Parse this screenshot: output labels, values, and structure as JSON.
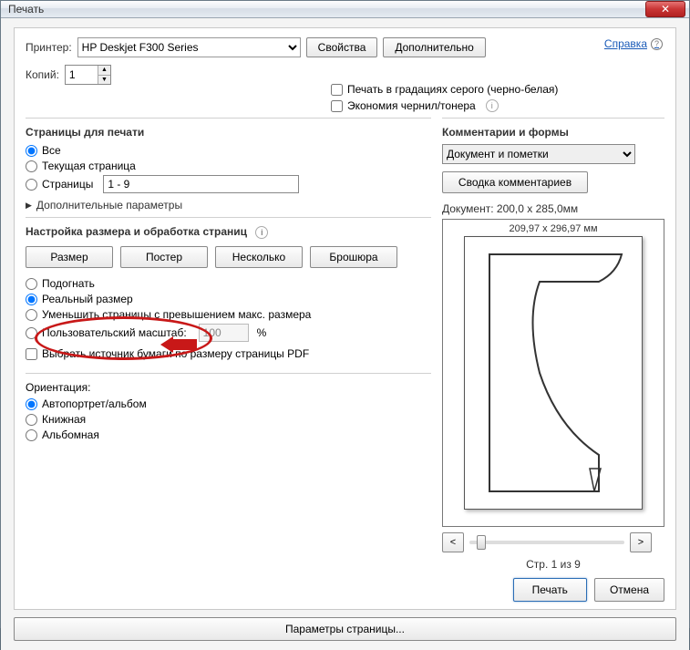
{
  "window": {
    "title": "Печать",
    "close": "✕"
  },
  "help": {
    "label": "Справка"
  },
  "printer": {
    "label": "Принтер:",
    "value": "HP Deskjet F300 Series",
    "properties_btn": "Свойства",
    "advanced_btn": "Дополнительно"
  },
  "copies": {
    "label": "Копий:",
    "value": "1"
  },
  "checks": {
    "grayscale": "Печать в градациях серого (черно-белая)",
    "save_ink": "Экономия чернил/тонера"
  },
  "pages": {
    "header": "Страницы для печати",
    "all": "Все",
    "current": "Текущая страница",
    "range_label": "Страницы",
    "range_value": "1 - 9",
    "more": "Дополнительные параметры"
  },
  "sizing": {
    "header": "Настройка размера и обработка страниц",
    "size_btn": "Размер",
    "poster_btn": "Постер",
    "multiple_btn": "Несколько",
    "booklet_btn": "Брошюра",
    "fit": "Подогнать",
    "actual": "Реальный размер",
    "shrink": "Уменьшить страницы с превышением макс. размера",
    "custom_label": "Пользовательский масштаб:",
    "custom_value": "100",
    "custom_unit": "%",
    "choose_source": "Выбрать источник бумаги по размеру страницы PDF"
  },
  "orientation": {
    "header": "Ориентация:",
    "auto": "Автопортрет/альбом",
    "portrait": "Книжная",
    "landscape": "Альбомная"
  },
  "comments": {
    "header": "Комментарии и формы",
    "value": "Документ и пометки",
    "summary_btn": "Сводка комментариев"
  },
  "preview": {
    "doc_dims": "Документ: 200,0 x 285,0мм",
    "page_dims": "209,97 x 296,97 мм",
    "page_counter": "Стр. 1 из 9",
    "prev": "<",
    "next": ">"
  },
  "footer": {
    "page_setup": "Параметры страницы...",
    "print": "Печать",
    "cancel": "Отмена"
  }
}
